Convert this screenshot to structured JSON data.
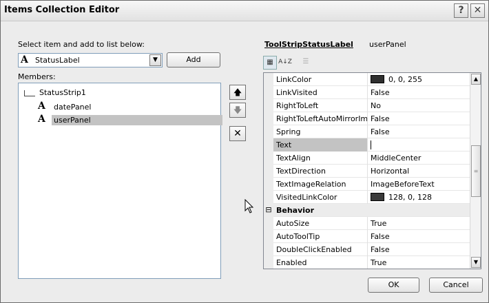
{
  "window": {
    "title": "Items Collection Editor"
  },
  "title_buttons": {
    "help": "?",
    "close": "✕"
  },
  "left": {
    "select_label": "Select item and add to list below:",
    "combo_glyph": "A",
    "combo_value": "StatusLabel",
    "add_label": "Add",
    "members_label": "Members:",
    "tree_root": "StatusStrip1",
    "items": [
      {
        "glyph": "A",
        "label": "datePanel"
      },
      {
        "glyph": "A",
        "label": "userPanel"
      }
    ]
  },
  "side_buttons": {
    "up": "🡅",
    "down": "🡇",
    "remove": "✕"
  },
  "grid": {
    "type_name": "ToolStripStatusLabel",
    "object_name": "userPanel",
    "toolbar": {
      "categorized": "▦",
      "alphabetical": "A↓Z",
      "pages": "☰"
    },
    "rows": [
      {
        "name": "LinkColor",
        "value": "0, 0, 255",
        "swatch": "#2f2f2f"
      },
      {
        "name": "LinkVisited",
        "value": "False"
      },
      {
        "name": "RightToLeft",
        "value": "No"
      },
      {
        "name": "RightToLeftAutoMirrorIm",
        "value": "False"
      },
      {
        "name": "Spring",
        "value": "False"
      },
      {
        "name": "Text",
        "value": ""
      },
      {
        "name": "TextAlign",
        "value": "MiddleCenter"
      },
      {
        "name": "TextDirection",
        "value": "Horizontal"
      },
      {
        "name": "TextImageRelation",
        "value": "ImageBeforeText"
      },
      {
        "name": "VisitedLinkColor",
        "value": "128, 0, 128",
        "swatch": "#3a3a3a"
      },
      {
        "category": "Behavior",
        "toggle": "⊟"
      },
      {
        "name": "AutoSize",
        "value": "True"
      },
      {
        "name": "AutoToolTip",
        "value": "False"
      },
      {
        "name": "DoubleClickEnabled",
        "value": "False"
      },
      {
        "name": "Enabled",
        "value": "True"
      }
    ]
  },
  "footer": {
    "ok": "OK",
    "cancel": "Cancel"
  }
}
